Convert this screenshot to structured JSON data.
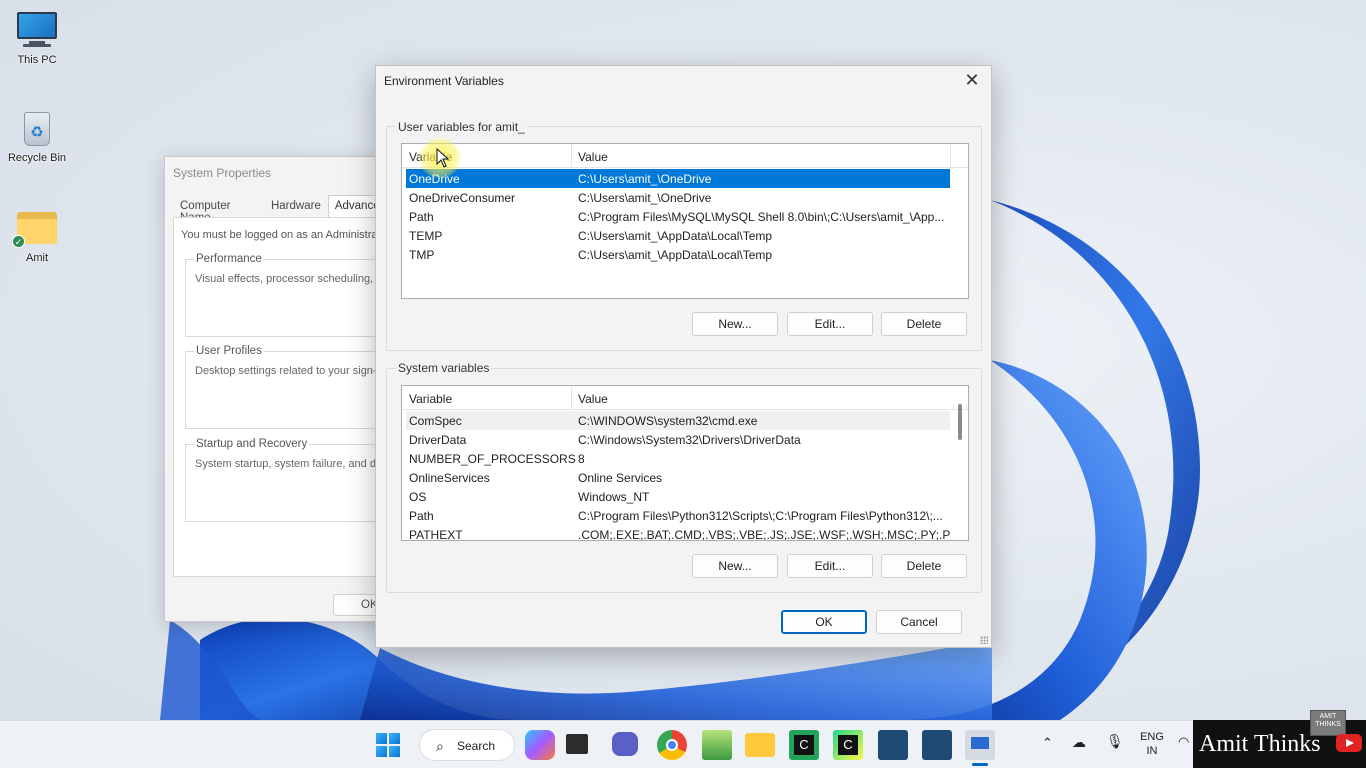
{
  "desktop": {
    "icons": [
      {
        "label": "This PC"
      },
      {
        "label": "Recycle Bin"
      },
      {
        "label": "Amit"
      }
    ]
  },
  "system_properties": {
    "title": "System Properties",
    "tabs": [
      "Computer Name",
      "Hardware",
      "Advanced"
    ],
    "active_tab": "Advanced",
    "admin_note": "You must be logged on as an Administra",
    "groups": [
      {
        "label": "Performance",
        "description": "Visual effects, processor scheduling, m"
      },
      {
        "label": "User Profiles",
        "description": "Desktop settings related to your sign-in"
      },
      {
        "label": "Startup and Recovery",
        "description": "System startup, system failure, and deb"
      }
    ],
    "ok_label": "OK"
  },
  "env_dialog": {
    "title": "Environment Variables",
    "close_glyph": "✕",
    "user_section_label": "User variables for amit_",
    "user_columns": {
      "variable": "Variable",
      "value": "Value"
    },
    "user_vars": [
      {
        "name": "OneDrive",
        "value": "C:\\Users\\amit_\\OneDrive",
        "selected": true
      },
      {
        "name": "OneDriveConsumer",
        "value": "C:\\Users\\amit_\\OneDrive"
      },
      {
        "name": "Path",
        "value": "C:\\Program Files\\MySQL\\MySQL Shell 8.0\\bin\\;C:\\Users\\amit_\\App..."
      },
      {
        "name": "TEMP",
        "value": "C:\\Users\\amit_\\AppData\\Local\\Temp"
      },
      {
        "name": "TMP",
        "value": "C:\\Users\\amit_\\AppData\\Local\\Temp"
      }
    ],
    "user_buttons": {
      "new": "New...",
      "edit": "Edit...",
      "delete": "Delete"
    },
    "system_section_label": "System variables",
    "system_columns": {
      "variable": "Variable",
      "value": "Value"
    },
    "system_vars": [
      {
        "name": "ComSpec",
        "value": "C:\\WINDOWS\\system32\\cmd.exe"
      },
      {
        "name": "DriverData",
        "value": "C:\\Windows\\System32\\Drivers\\DriverData"
      },
      {
        "name": "NUMBER_OF_PROCESSORS",
        "value": "8"
      },
      {
        "name": "OnlineServices",
        "value": "Online Services"
      },
      {
        "name": "OS",
        "value": "Windows_NT"
      },
      {
        "name": "Path",
        "value": "C:\\Program Files\\Python312\\Scripts\\;C:\\Program Files\\Python312\\;..."
      },
      {
        "name": "PATHEXT",
        "value": ".COM;.EXE;.BAT;.CMD;.VBS;.VBE;.JS;.JSE;.WSF;.WSH;.MSC;.PY;.PYW"
      }
    ],
    "system_buttons": {
      "new": "New...",
      "edit": "Edit...",
      "delete": "Delete"
    },
    "ok_label": "OK",
    "cancel_label": "Cancel"
  },
  "taskbar": {
    "search_label": "Search",
    "apps": [
      "start-icon",
      "copilot-icon",
      "task-view-icon",
      "chat-icon",
      "chrome-icon",
      "notepad-icon",
      "file-explorer-icon",
      "pycharm-icon",
      "clion-icon",
      "mysql-workbench-icon",
      "mysql-workbench-icon",
      "system-properties-icon"
    ],
    "language": "ENG",
    "region": "IN"
  },
  "branding": {
    "channel_name": "Amit Thinks",
    "mini_logo": "AMIT THINKS"
  },
  "colors": {
    "selection": "#0078d7",
    "primary_border": "#0067c0",
    "wallpaper_blue": "#1a5fd6"
  }
}
